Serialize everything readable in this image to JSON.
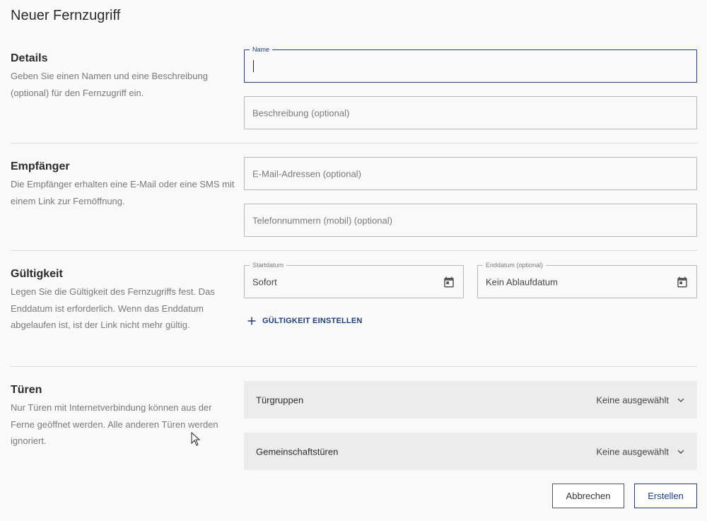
{
  "page": {
    "title": "Neuer Fernzugriff"
  },
  "colors": {
    "accent": "#1f3e75",
    "background": "#f9f9f9",
    "panel": "#ececec",
    "muted_text": "#7a7a7a"
  },
  "details": {
    "title": "Details",
    "description": "Geben Sie einen Namen und eine Beschreibung (optional) für den Fernzugriff ein.",
    "name_field": {
      "label": "Name",
      "value": ""
    },
    "description_field": {
      "placeholder": "Beschreibung (optional)"
    }
  },
  "recipients": {
    "title": "Empfänger",
    "description": "Die Empfänger erhalten eine E-Mail oder eine SMS mit einem Link zur Fernöffnung.",
    "email_field": {
      "placeholder": "E-Mail-Adressen (optional)"
    },
    "phone_field": {
      "placeholder": "Telefonnummern (mobil) (optional)"
    }
  },
  "validity": {
    "title": "Gültigkeit",
    "description": "Legen Sie die Gültigkeit des Fernzugriffs fest. Das Enddatum ist erforderlich. Wenn das Enddatum abgelaufen ist, ist der Link nicht mehr gültig.",
    "start_field": {
      "label": "Startdatum",
      "value": "Sofort",
      "icon": "calendar-icon"
    },
    "end_field": {
      "label": "Enddatum (optional)",
      "value": "Kein Ablaufdatum",
      "icon": "calendar-icon"
    },
    "add_link": {
      "label": "GÜLTIGKEIT EINSTELLEN",
      "icon": "plus-icon"
    }
  },
  "doors": {
    "title": "Türen",
    "description": "Nur Türen mit Internetverbindung können aus der Ferne geöffnet werden. Alle anderen Türen werden ignoriert.",
    "door_groups": {
      "title": "Türgruppen",
      "value": "Keine ausgewählt",
      "icon": "chevron-down-icon"
    },
    "shared_doors": {
      "title": "Gemeinschaftstüren",
      "value": "Keine ausgewählt",
      "icon": "chevron-down-icon"
    }
  },
  "actions": {
    "cancel_label": "Abbrechen",
    "create_label": "Erstellen"
  }
}
